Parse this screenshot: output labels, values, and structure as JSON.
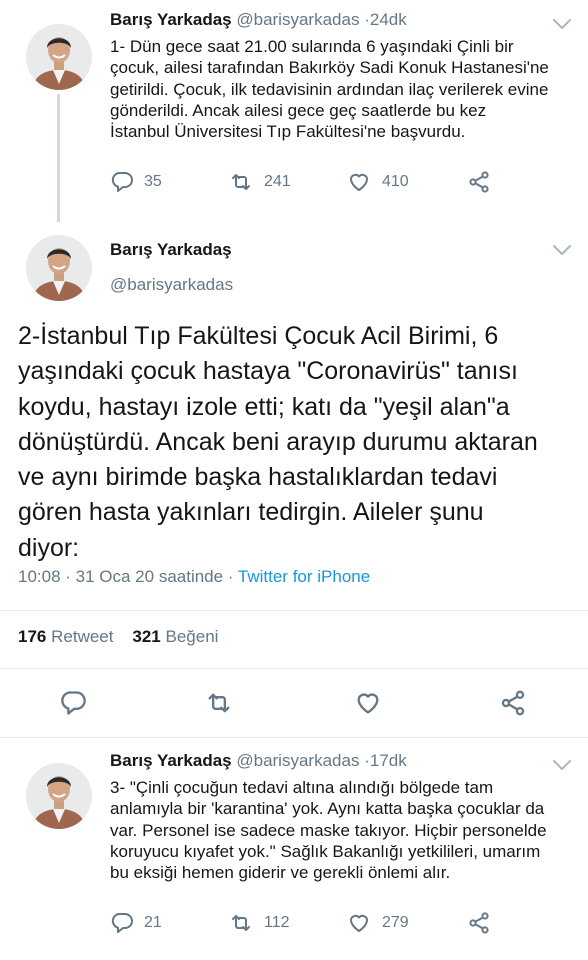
{
  "tweets": [
    {
      "name": "Barış Yarkadaş",
      "handle": "@barisyarkadas",
      "sep": "·",
      "time": "24dk",
      "lines": [
        "1- Dün gece saat 21.00 sularında 6 yaşındaki Çinli bir",
        "çocuk, ailesi tarafından Bakırköy Sadi Konuk Hastanesi'ne",
        "getirildi. Çocuk, ilk tedavisinin ardından ilaç verilerek evine",
        "gönderildi. Ancak ailesi gece geç saatlerde bu kez",
        "İstanbul Üniversitesi Tıp Fakültesi'ne başvurdu."
      ],
      "replies": "35",
      "retweets": "241",
      "likes": "410"
    },
    {
      "name": "Barış Yarkadaş",
      "handle": "@barisyarkadas",
      "lines": [
        "2-İstanbul Tıp Fakültesi Çocuk Acil Birimi, 6",
        "yaşındaki çocuk hastaya \"Coronavirüs\" tanısı",
        "koydu, hastayı izole etti; katı da \"yeşil alan\"a",
        "dönüştürdü. Ancak beni arayıp durumu aktaran",
        "ve aynı birimde başka hastalıklardan tedavi",
        "gören hasta yakınları tedirgin. Aileler şunu",
        "diyor:"
      ],
      "timestamp": "10:08 · 31 Oca 20 saatinde ·",
      "source": "Twitter for iPhone",
      "retweet_count": "176",
      "retweet_label": "Retweet",
      "like_count": "321",
      "like_label": "Beğeni"
    },
    {
      "name": "Barış Yarkadaş",
      "handle": "@barisyarkadas",
      "sep": "·",
      "time": "17dk",
      "lines": [
        "3- \"Çinli çocuğun tedavi altına alındığı bölgede tam",
        "anlamıyla bir 'karantina' yok. Aynı katta başka çocuklar da",
        "var. Personel ise sadece maske takıyor. Hiçbir personelde",
        "koruyucu kıyafet yok.\" Sağlık Bakanlığı yetkilileri, umarım",
        "bu eksiği hemen giderir ve gerekli önlemi alır."
      ],
      "replies": "21",
      "retweets": "112",
      "likes": "279"
    }
  ],
  "icons": {
    "reply": "reply-icon",
    "retweet": "retweet-icon",
    "like": "heart-icon",
    "share": "share-icon",
    "menu": "chevron-down-icon"
  },
  "colors": {
    "link": "#1b95e0",
    "muted": "#657786",
    "text": "#14171a"
  }
}
